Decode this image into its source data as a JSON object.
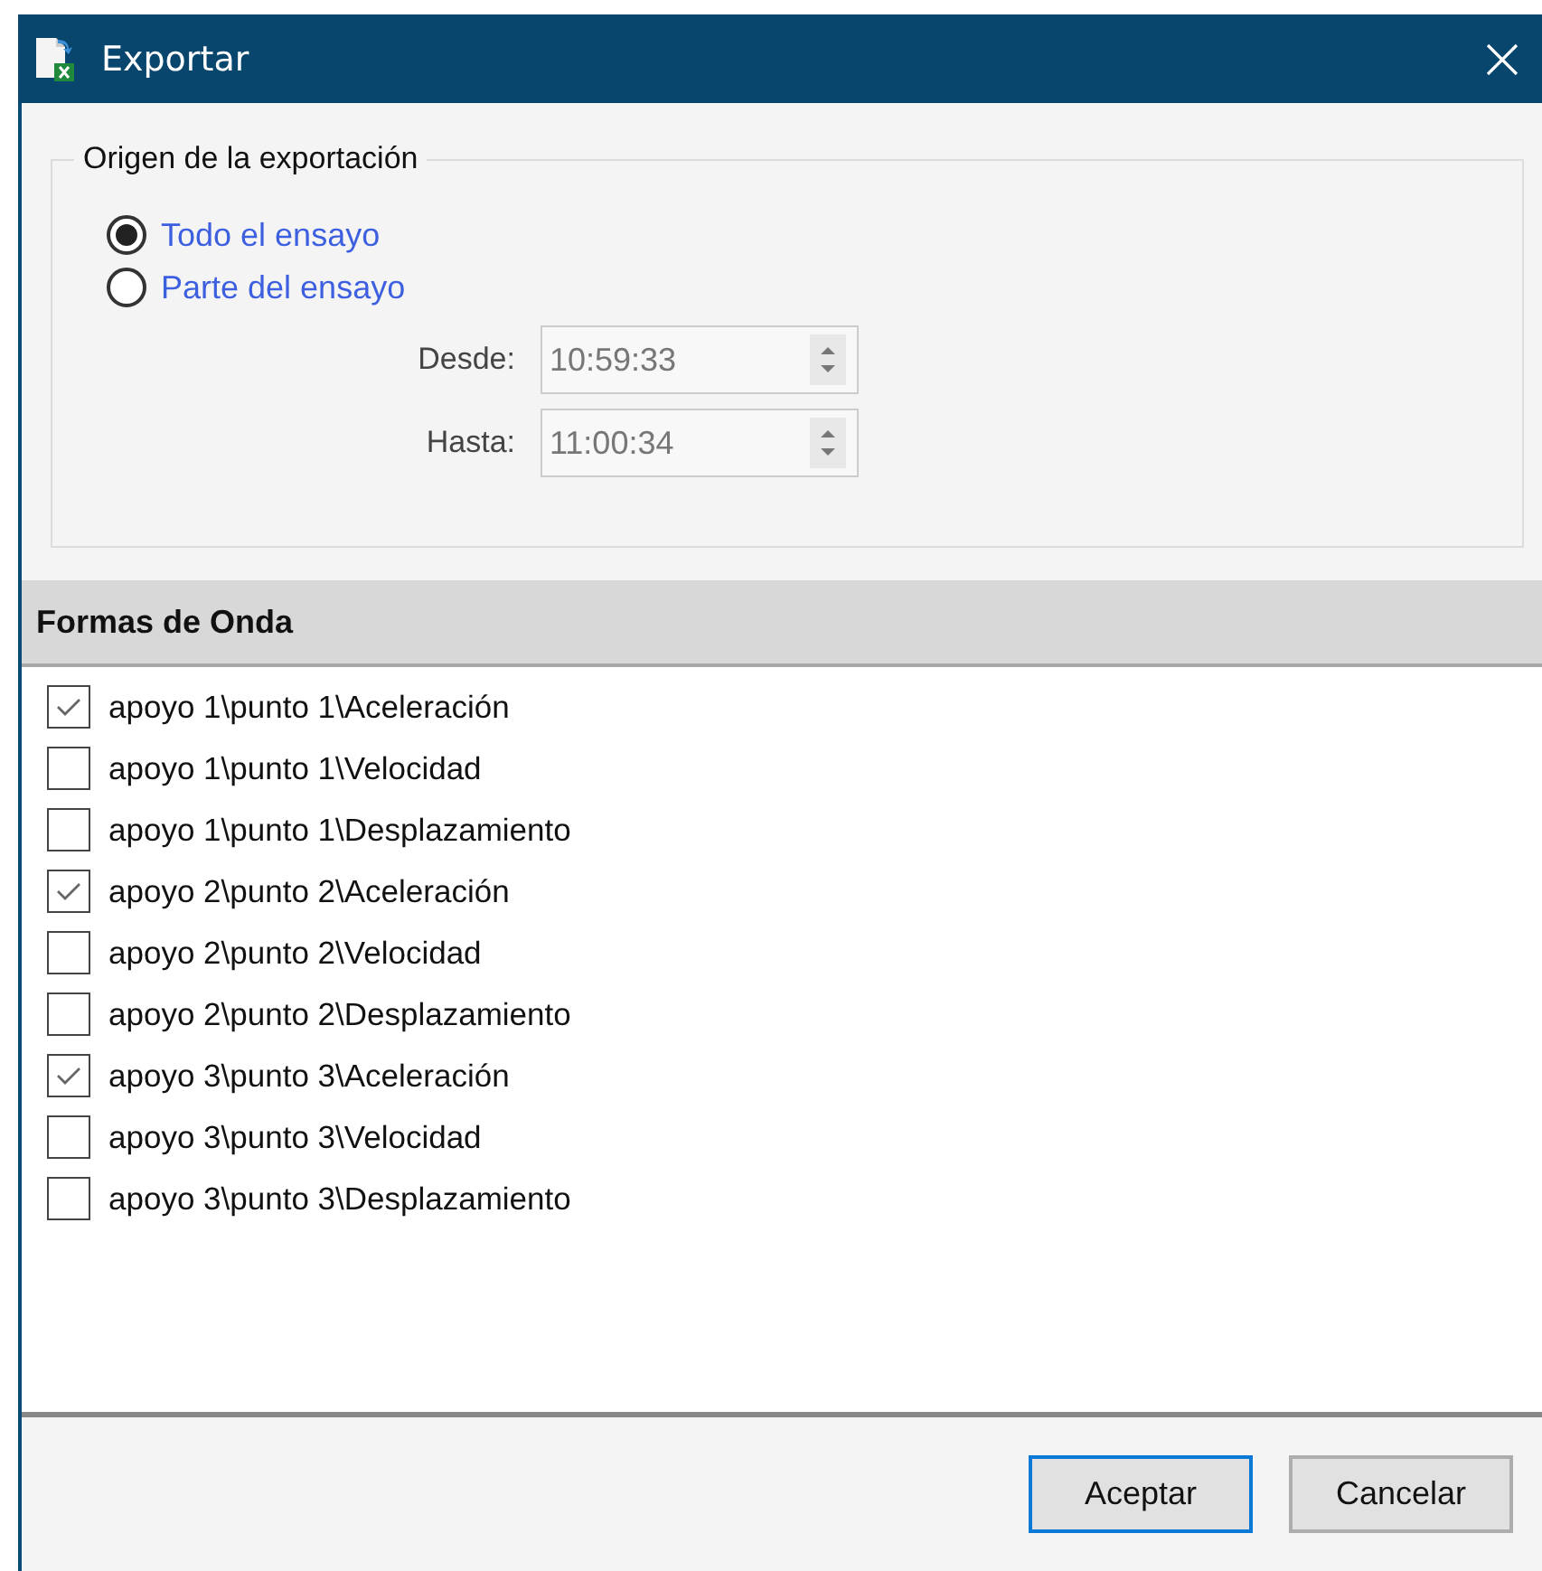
{
  "window": {
    "title": "Exportar"
  },
  "export_source": {
    "title": "Origen de la exportación",
    "options": [
      {
        "label": "Todo el ensayo",
        "selected": true
      },
      {
        "label": "Parte del ensayo",
        "selected": false
      }
    ],
    "fields": [
      {
        "label": "Desde:",
        "value": "10:59:33",
        "disabled": true
      },
      {
        "label": "Hasta:",
        "value": "11:00:34",
        "disabled": true
      }
    ]
  },
  "waveforms": {
    "header": "Formas de Onda",
    "items": [
      {
        "label": "apoyo 1\\punto 1\\Aceleración",
        "checked": true
      },
      {
        "label": "apoyo 1\\punto 1\\Velocidad",
        "checked": false
      },
      {
        "label": "apoyo 1\\punto 1\\Desplazamiento",
        "checked": false
      },
      {
        "label": "apoyo 2\\punto 2\\Aceleración",
        "checked": true
      },
      {
        "label": "apoyo 2\\punto 2\\Velocidad",
        "checked": false
      },
      {
        "label": "apoyo 2\\punto 2\\Desplazamiento",
        "checked": false
      },
      {
        "label": "apoyo 3\\punto 3\\Aceleración",
        "checked": true
      },
      {
        "label": "apoyo 3\\punto 3\\Velocidad",
        "checked": false
      },
      {
        "label": "apoyo 3\\punto 3\\Desplazamiento",
        "checked": false
      }
    ]
  },
  "buttons": [
    {
      "label": "Aceptar",
      "selected": true
    },
    {
      "label": "Cancelar",
      "selected": false
    }
  ]
}
